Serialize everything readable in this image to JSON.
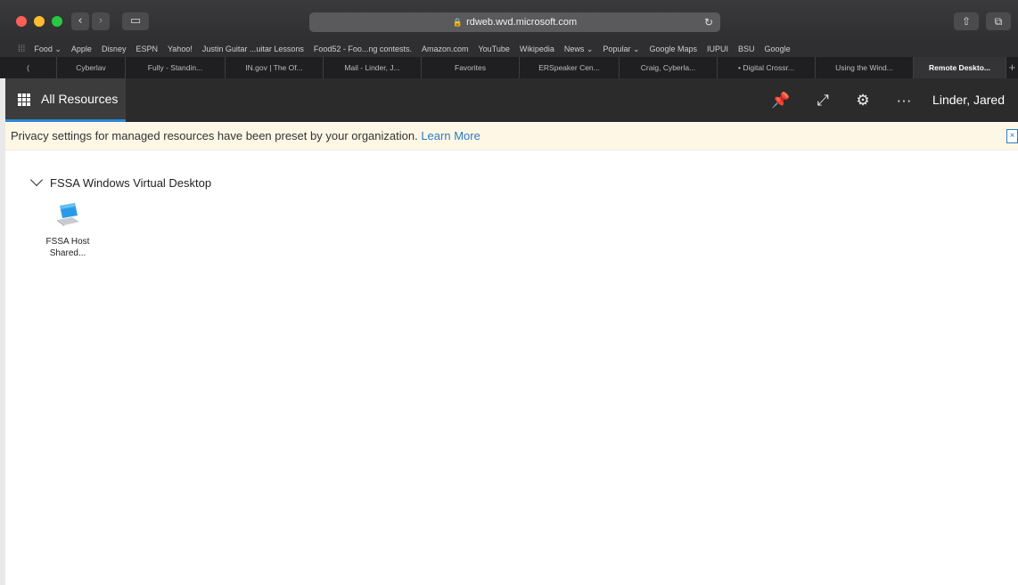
{
  "browser": {
    "url": "rdweb.wvd.microsoft.com",
    "bookmarks": [
      "Food ⌄",
      "Apple",
      "Disney",
      "ESPN",
      "Yahoo!",
      "Justin Guitar ...uitar Lessons",
      "Food52 - Foo...ng contests.",
      "Amazon.com",
      "YouTube",
      "Wikipedia",
      "News ⌄",
      "Popular ⌄",
      "Google Maps",
      "IUPUI",
      "BSU",
      "Google"
    ],
    "tabs": [
      "(",
      "Cyberlav",
      "Fully - Standin...",
      "IN.gov | The Of...",
      "Mail - Linder, J...",
      "Favorites",
      "ERSpeaker Cen...",
      "Craig, Cyberla...",
      "• Digital Crossr...",
      "Using the Wind...",
      "Remote Deskto..."
    ],
    "active_tab_index": 10
  },
  "app": {
    "all_resources_label": "All Resources",
    "user_name": "Linder, Jared"
  },
  "privacy": {
    "message": "Privacy settings for managed resources have been preset by your organization.",
    "link": "Learn More"
  },
  "group": {
    "name": "FSSA Windows Virtual Desktop"
  },
  "resources": [
    {
      "label_line1": "FSSA Host",
      "label_line2": "Shared..."
    }
  ],
  "colors": {
    "accent": "#2b88d8",
    "header_bg": "#2b2b2b",
    "banner_bg": "#fff7e5",
    "link": "#2a7ac6"
  }
}
